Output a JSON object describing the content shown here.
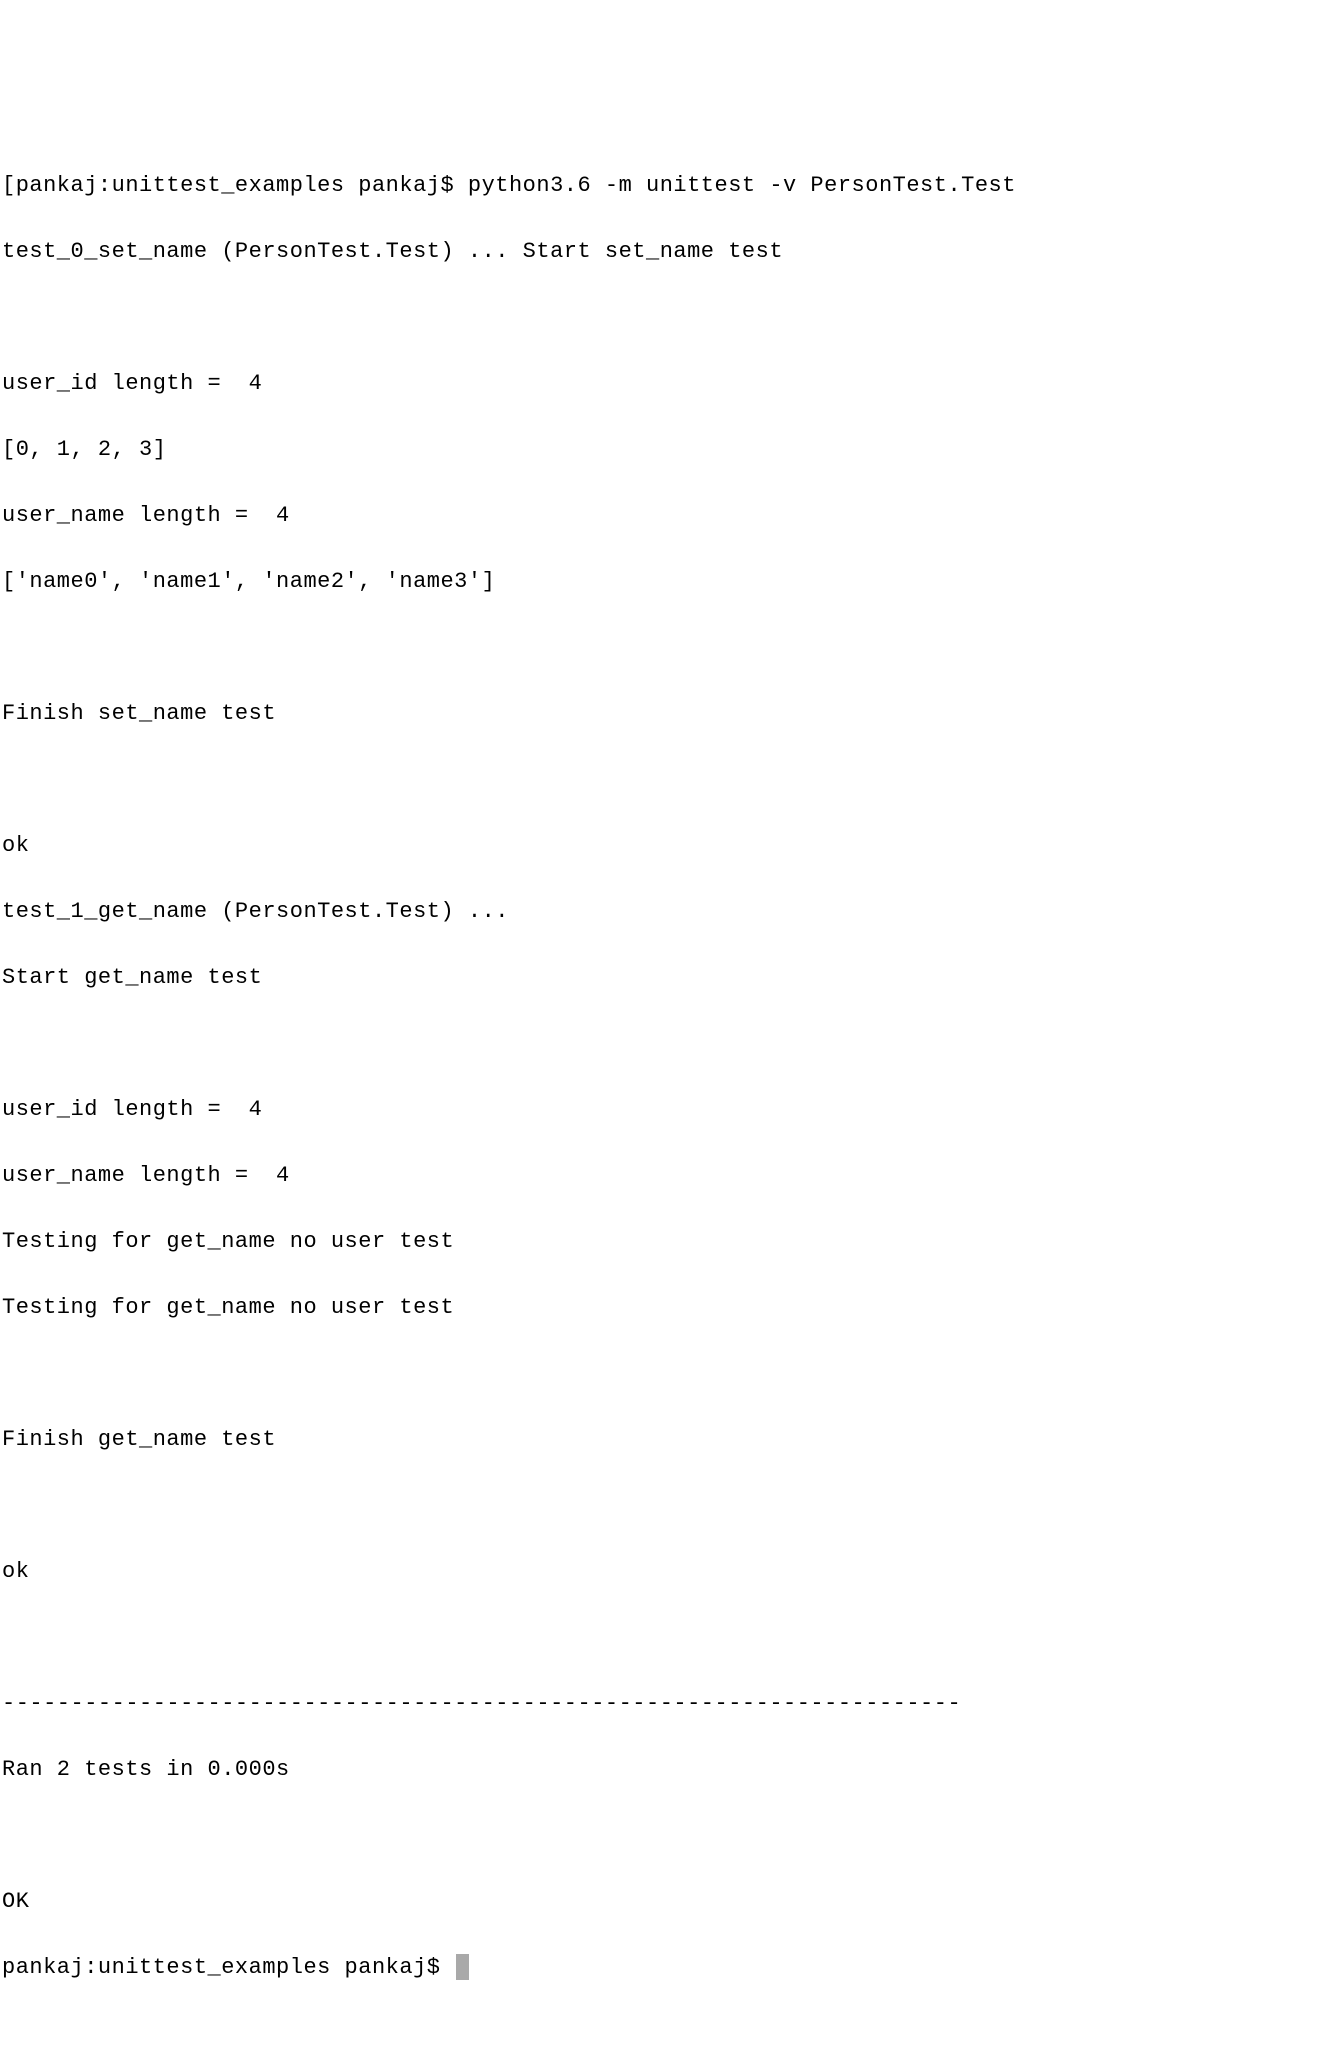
{
  "lines": {
    "l0": "[pankaj:unittest_examples pankaj$ python3.6 -m unittest -v PersonTest.Test",
    "l1": "test_0_set_name (PersonTest.Test) ... Start set_name test",
    "l2": "",
    "l3": "user_id length =  4",
    "l4": "[0, 1, 2, 3]",
    "l5": "user_name length =  4",
    "l6": "['name0', 'name1', 'name2', 'name3']",
    "l7": "",
    "l8": "Finish set_name test",
    "l9": "",
    "l10": "ok",
    "l11": "test_1_get_name (PersonTest.Test) ... ",
    "l12": "Start get_name test",
    "l13": "",
    "l14": "user_id length =  4",
    "l15": "user_name length =  4",
    "l16": "Testing for get_name no user test",
    "l17": "Testing for get_name no user test",
    "l18": "",
    "l19": "Finish get_name test",
    "l20": "",
    "l21": "ok",
    "l22": "",
    "l23": "----------------------------------------------------------------------",
    "l24": "Ran 2 tests in 0.000s",
    "l25": "",
    "l26": "OK",
    "l27": "pankaj:unittest_examples pankaj$ "
  }
}
